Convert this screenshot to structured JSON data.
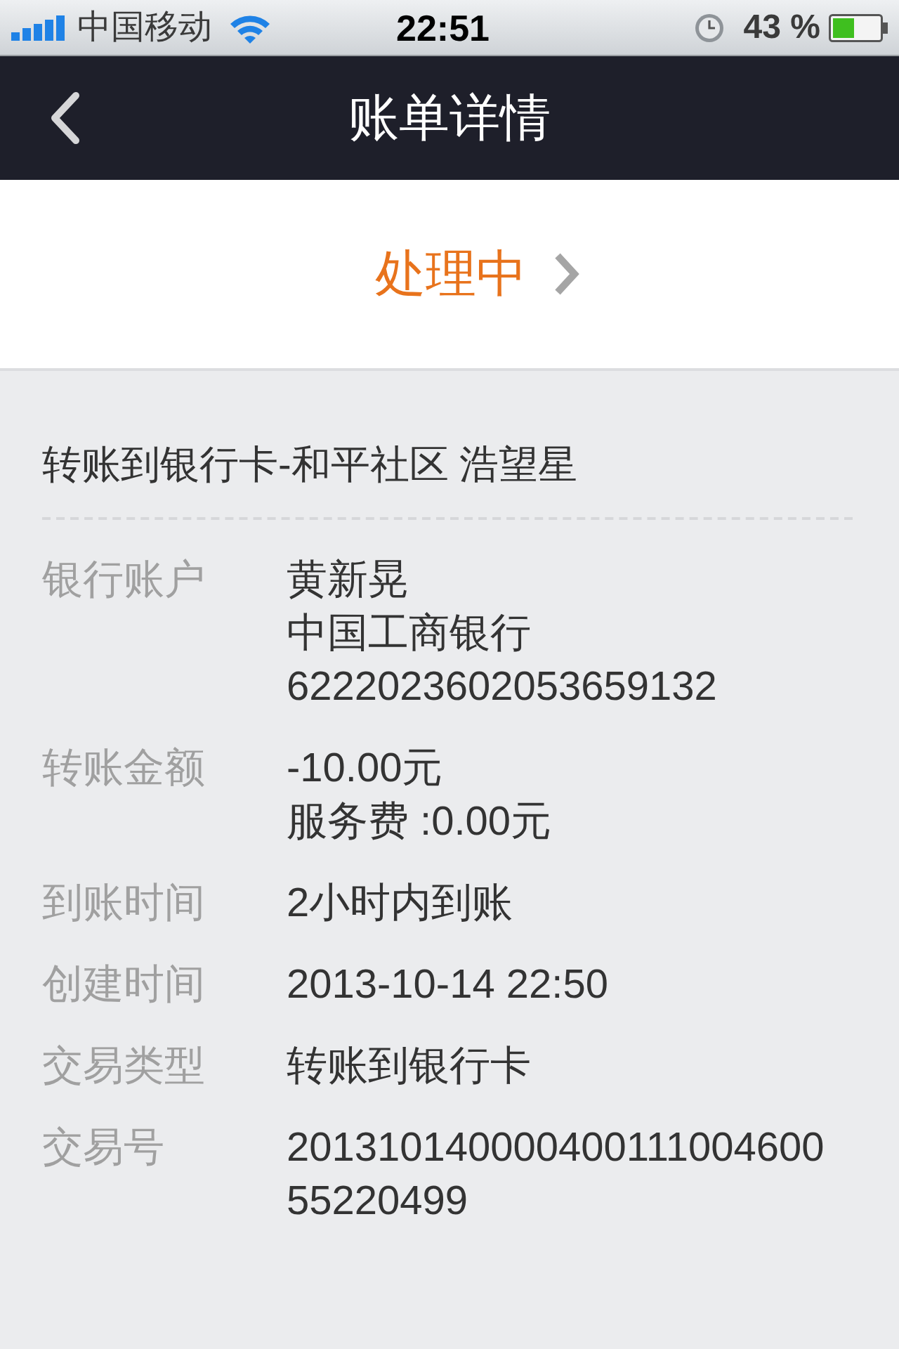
{
  "status_bar": {
    "carrier": "中国移动",
    "time": "22:51",
    "battery": "43 %"
  },
  "nav_bar": {
    "title": "账单详情"
  },
  "status": {
    "label": "处理中"
  },
  "detail": {
    "title": "转账到银行卡-和平社区 浩望星",
    "rows": [
      {
        "label": "银行账户",
        "values": [
          "黄新晃",
          "中国工商银行",
          "6222023602053659132"
        ]
      },
      {
        "label": "转账金额",
        "values": [
          "-10.00元",
          "服务费 :0.00元"
        ]
      },
      {
        "label": "到账时间",
        "values": [
          "2小时内到账"
        ]
      },
      {
        "label": "创建时间",
        "values": [
          "2013-10-14 22:50"
        ]
      },
      {
        "label": "交易类型",
        "values": [
          "转账到银行卡"
        ]
      },
      {
        "label": "交易号",
        "values": [
          "20131014000040011100460055220499"
        ]
      }
    ]
  }
}
